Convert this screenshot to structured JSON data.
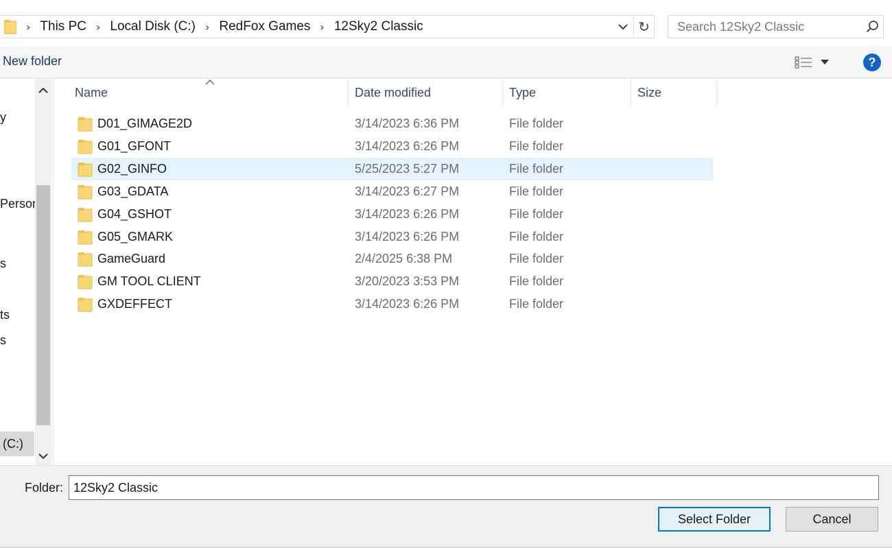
{
  "breadcrumb": {
    "items": [
      "This PC",
      "Local Disk (C:)",
      "RedFox Games",
      "12Sky2 Classic"
    ]
  },
  "search": {
    "placeholder": "Search 12Sky2 Classic"
  },
  "toolbar": {
    "new_folder_label": "New folder"
  },
  "nav": {
    "items": [
      {
        "label": "y"
      },
      {
        "label": "Persor"
      },
      {
        "label": "s"
      },
      {
        "label": "ts"
      },
      {
        "label": "s"
      },
      {
        "label": "(C:)"
      }
    ]
  },
  "columns": {
    "name": "Name",
    "date": "Date modified",
    "type": "Type",
    "size": "Size"
  },
  "files": [
    {
      "name": "D01_GIMAGE2D",
      "date": "3/14/2023 6:36 PM",
      "type": "File folder"
    },
    {
      "name": "G01_GFONT",
      "date": "3/14/2023 6:26 PM",
      "type": "File folder"
    },
    {
      "name": "G02_GINFO",
      "date": "5/25/2023 5:27 PM",
      "type": "File folder"
    },
    {
      "name": "G03_GDATA",
      "date": "3/14/2023 6:27 PM",
      "type": "File folder"
    },
    {
      "name": "G04_GSHOT",
      "date": "3/14/2023 6:26 PM",
      "type": "File folder"
    },
    {
      "name": "G05_GMARK",
      "date": "3/14/2023 6:26 PM",
      "type": "File folder"
    },
    {
      "name": "GameGuard",
      "date": "2/4/2025 6:38 PM",
      "type": "File folder"
    },
    {
      "name": "GM TOOL CLIENT",
      "date": "3/20/2023 3:53 PM",
      "type": "File folder"
    },
    {
      "name": "GXDEFFECT",
      "date": "3/14/2023 6:26 PM",
      "type": "File folder"
    }
  ],
  "bottom": {
    "folder_label": "Folder:",
    "folder_value": "12Sky2 Classic",
    "select_label": "Select Folder",
    "cancel_label": "Cancel"
  },
  "colors": {
    "selection": "#e5f3ff",
    "accent": "#0078d7",
    "folder": "#f8d775"
  }
}
